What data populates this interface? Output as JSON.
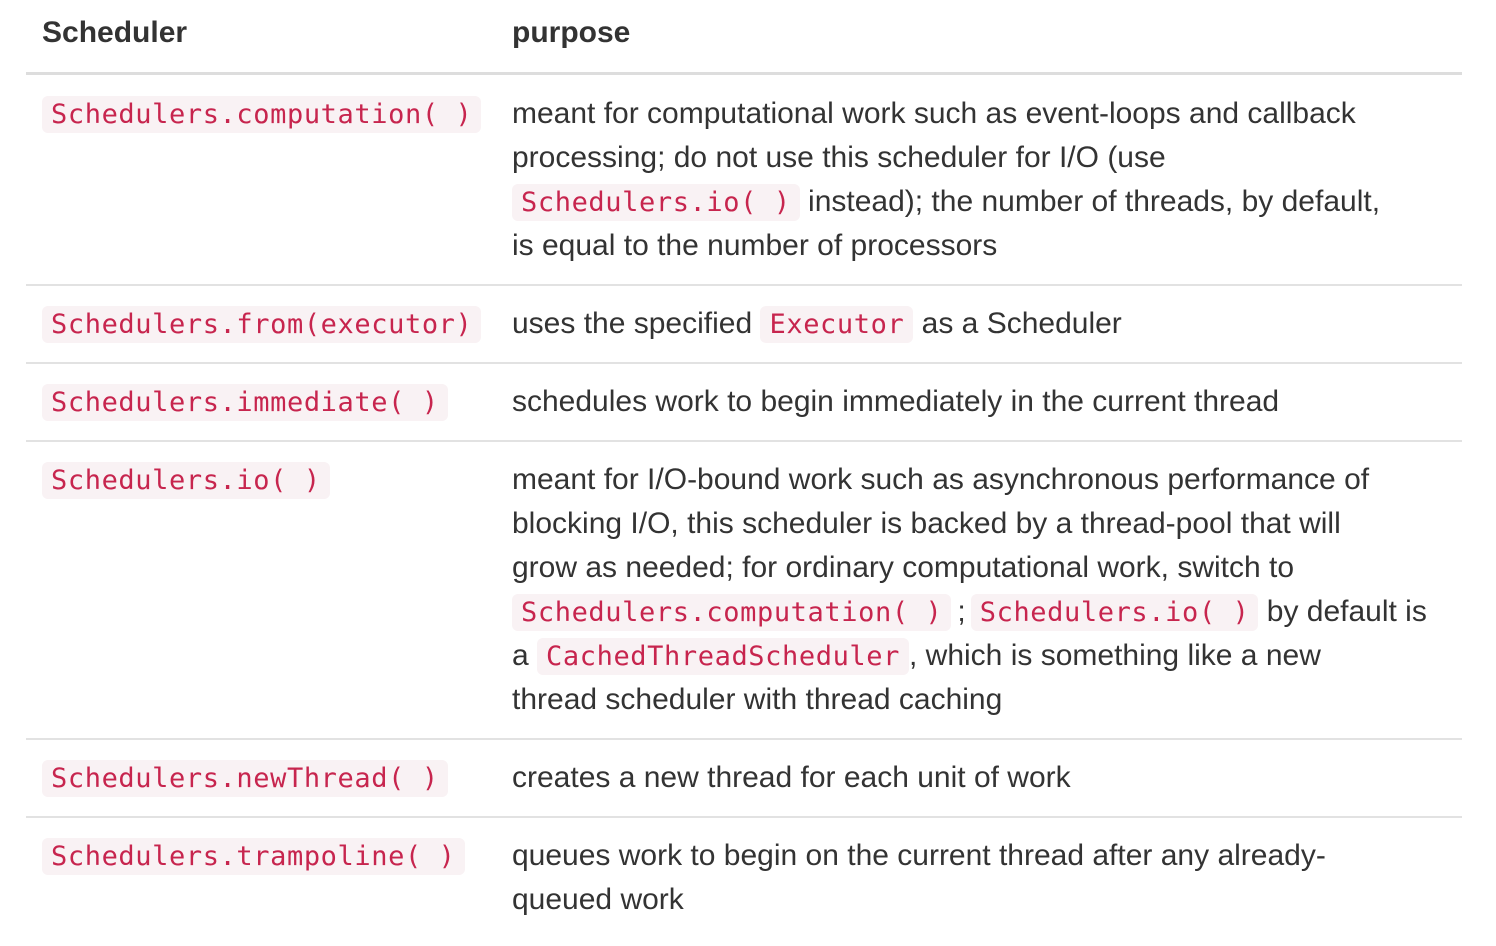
{
  "table": {
    "headers": {
      "scheduler": "Scheduler",
      "purpose": "purpose"
    },
    "rows": [
      {
        "scheduler": "Schedulers.computation( )",
        "purpose_line1": "meant for computational work such as event-loops and callback",
        "purpose_line2": "processing; do not use this scheduler for I/O (use",
        "purpose_code1": "Schedulers.io( )",
        "purpose_line3_after": " instead); the number of threads, by default,",
        "purpose_line4": "is equal to the number of processors"
      },
      {
        "scheduler": "Schedulers.from(executor)",
        "purpose_before": "uses the specified ",
        "purpose_code1": "Executor",
        "purpose_after": " as a Scheduler"
      },
      {
        "scheduler": "Schedulers.immediate( )",
        "purpose": "schedules work to begin immediately in the current thread"
      },
      {
        "scheduler": "Schedulers.io( )",
        "purpose_line1": "meant for I/O-bound work such as asynchronous performance of",
        "purpose_line2": "blocking I/O, this scheduler is backed by a thread-pool that will",
        "purpose_line3": "grow as needed; for ordinary computational work, switch to",
        "purpose_code1": "Schedulers.computation( )",
        "purpose_sep": ";",
        "purpose_code2": "Schedulers.io( )",
        "purpose_after2": " by default is",
        "purpose_line5_before": "a ",
        "purpose_code3": "CachedThreadScheduler",
        "purpose_line5_after": ", which is something like a new",
        "purpose_line6": "thread scheduler with thread caching"
      },
      {
        "scheduler": "Schedulers.newThread( )",
        "purpose": "creates a new thread for each unit of work"
      },
      {
        "scheduler": "Schedulers.trampoline( )",
        "purpose_line1": "queues work to begin on the current thread after any already-",
        "purpose_line2": "queued work"
      }
    ]
  }
}
